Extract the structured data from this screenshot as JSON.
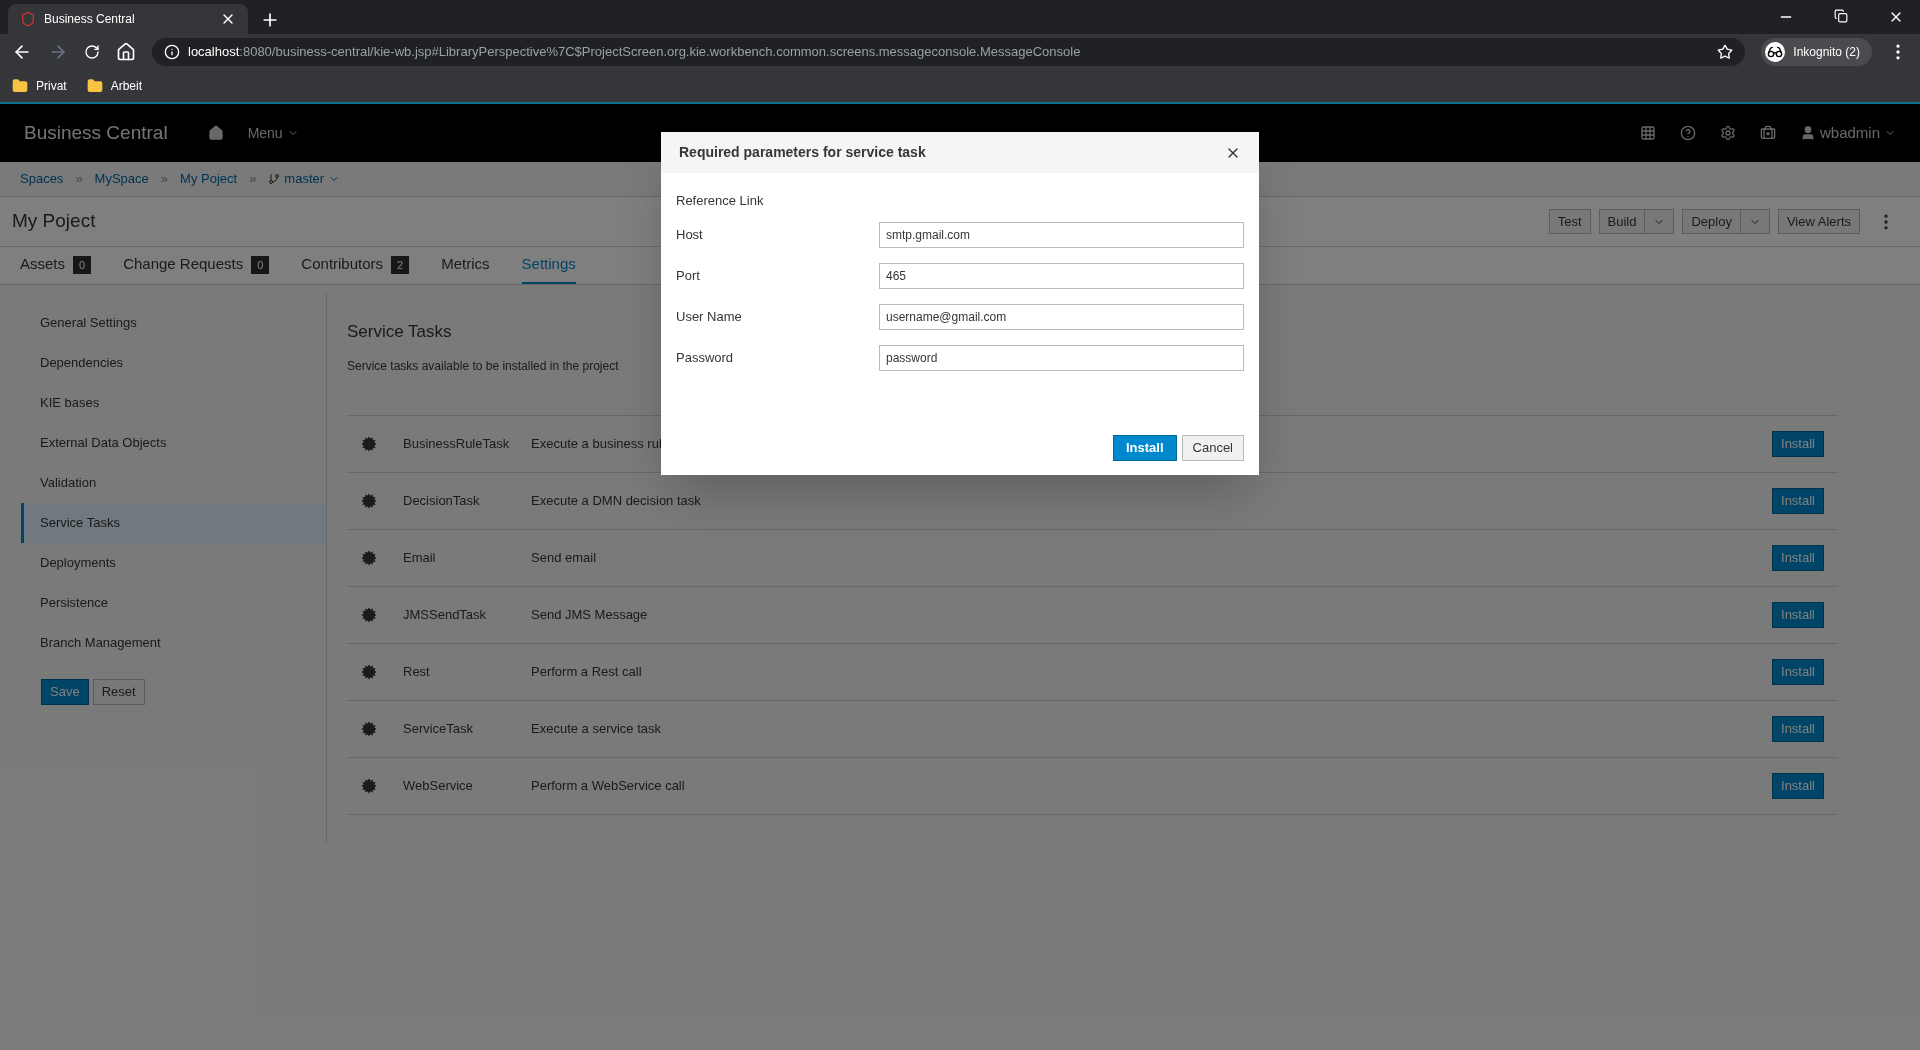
{
  "browser": {
    "tab_title": "Business Central",
    "url_host": "localhost",
    "url_path": ":8080/business-central/kie-wb.jsp#LibraryPerspective%7C$ProjectScreen.org.kie.workbench.common.screens.messageconsole.MessageConsole",
    "profile": "Inkognito (2)",
    "bookmarks": [
      "Privat",
      "Arbeit"
    ]
  },
  "header": {
    "brand": "Business Central",
    "menu": "Menu",
    "user": "wbadmin"
  },
  "breadcrumb": [
    "Spaces",
    "MySpace",
    "My Poject"
  ],
  "breadcrumb_separator": "»",
  "branch": "master",
  "project_title": "My Poject",
  "toolbar": [
    {
      "label": "Test",
      "dropdown": false
    },
    {
      "label": "Build",
      "dropdown": true
    },
    {
      "label": "Deploy",
      "dropdown": true
    },
    {
      "label": "View Alerts",
      "dropdown": false
    }
  ],
  "tabs": [
    {
      "label": "Assets",
      "badge": "0",
      "selected": false
    },
    {
      "label": "Change Requests",
      "badge": "0",
      "selected": false
    },
    {
      "label": "Contributors",
      "badge": "2",
      "selected": false
    },
    {
      "label": "Metrics",
      "selected": false
    },
    {
      "label": "Settings",
      "selected": true
    }
  ],
  "sidebar": {
    "items": [
      {
        "label": "General Settings",
        "selected": false
      },
      {
        "label": "Dependencies",
        "selected": false
      },
      {
        "label": "KIE bases",
        "selected": false
      },
      {
        "label": "External Data Objects",
        "selected": false
      },
      {
        "label": "Validation",
        "selected": false
      },
      {
        "label": "Service Tasks",
        "selected": true
      },
      {
        "label": "Deployments",
        "selected": false
      },
      {
        "label": "Persistence",
        "selected": false
      },
      {
        "label": "Branch Management",
        "selected": false
      }
    ],
    "save": "Save",
    "reset": "Reset"
  },
  "section": {
    "title": "Service Tasks",
    "description": "Service tasks available to be installed in the project"
  },
  "tasks": [
    {
      "name": "BusinessRuleTask",
      "description": "Execute a business rul",
      "action": "Install"
    },
    {
      "name": "DecisionTask",
      "description": "Execute a DMN decision task",
      "action": "Install"
    },
    {
      "name": "Email",
      "description": "Send email",
      "action": "Install"
    },
    {
      "name": "JMSSendTask",
      "description": "Send JMS Message",
      "action": "Install"
    },
    {
      "name": "Rest",
      "description": "Perform a Rest call",
      "action": "Install"
    },
    {
      "name": "ServiceTask",
      "description": "Execute a service task",
      "action": "Install"
    },
    {
      "name": "WebService",
      "description": "Perform a WebService call",
      "action": "Install"
    }
  ],
  "modal": {
    "title": "Required parameters for service task",
    "link": "Reference Link",
    "fields": [
      {
        "label": "Host",
        "value": "smtp.gmail.com"
      },
      {
        "label": "Port",
        "value": "465"
      },
      {
        "label": "User Name",
        "value": "username@gmail.com"
      },
      {
        "label": "Password",
        "value": "password"
      }
    ],
    "primary": "Install",
    "cancel": "Cancel"
  }
}
